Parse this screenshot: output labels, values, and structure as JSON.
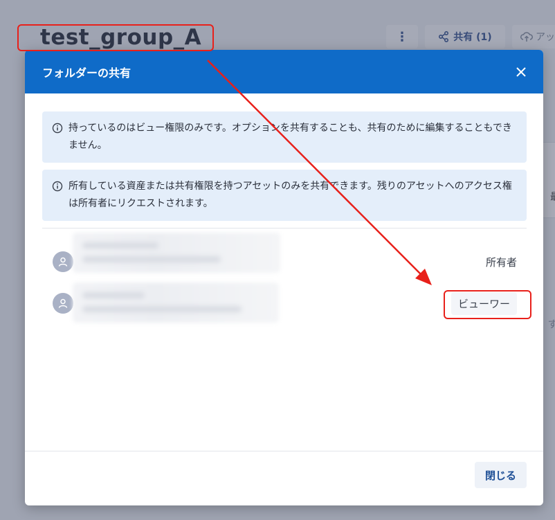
{
  "background": {
    "page_title": "test_group_A",
    "more_icon": "vertical-dots-icon",
    "share_button_label": "共有 (1)",
    "upload_button_label": "アッ",
    "right_char_1": "最",
    "right_char_2": "ず"
  },
  "dialog": {
    "title": "フォルダーの共有",
    "close_icon": "close-icon",
    "info_messages": [
      "持っているのはビュー権限のみです。オプションを共有することも、共有のために編集することもできません。",
      "所有している資産または共有権限を持つアセットのみを共有できます。残りのアセットへのアクセス権は所有者にリクエストされます。"
    ],
    "members": [
      {
        "role": "所有者"
      },
      {
        "role": "ビューワー"
      }
    ],
    "footer_close_label": "閉じる"
  },
  "colors": {
    "header_blue": "#0f6bc8",
    "info_bg": "#e4eefa",
    "annotation_red": "#e8201a"
  }
}
